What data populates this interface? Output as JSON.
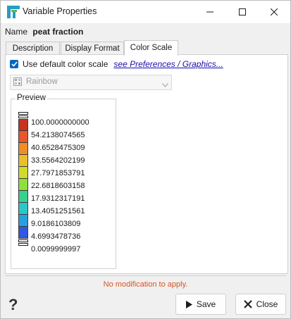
{
  "window": {
    "title": "Variable Properties",
    "icon": "app-logo-icon",
    "controls": [
      "minimize-icon",
      "maximize-icon",
      "close-icon"
    ]
  },
  "name_row": {
    "label": "Name",
    "value": "peat fraction"
  },
  "tabs": [
    {
      "label": "Description",
      "active": false
    },
    {
      "label": "Display Format",
      "active": false
    },
    {
      "label": "Color Scale",
      "active": true
    }
  ],
  "color_scale": {
    "use_default_label": "Use default color scale",
    "use_default_checked": true,
    "link_text": "see Preferences / Graphics...",
    "palette_selected": "Rainbow",
    "palette_enabled": false
  },
  "preview": {
    "title": "Preview",
    "labels": [
      "100.0000000000",
      "54.2138074565",
      "40.6528475309",
      "33.5564202199",
      "27.7971853791",
      "22.6818603158",
      "17.9312317191",
      "13.4051251561",
      "9.0186103809",
      "4.6993478736",
      "0.0099999997"
    ],
    "colors": [
      "#c8321e",
      "#e8572a",
      "#f08c2a",
      "#e8c02a",
      "#d0dc2a",
      "#8ee03a",
      "#38d090",
      "#2ac8c8",
      "#28a0e0",
      "#3058e0"
    ]
  },
  "status": "No modification to apply.",
  "buttons": {
    "save": "Save",
    "close": "Close",
    "help_icon": "help-icon"
  },
  "colors": {
    "accent": "#0067c0",
    "status": "#d9531e",
    "link": "#1a0dab"
  }
}
